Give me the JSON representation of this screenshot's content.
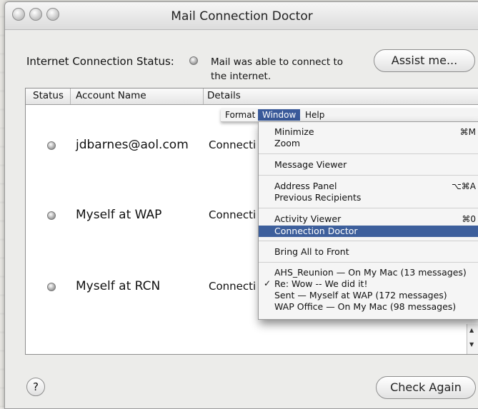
{
  "window": {
    "title": "Mail Connection Doctor"
  },
  "connection": {
    "label": "Internet Connection Status:",
    "status_line1": "Mail was able to connect to",
    "status_line2": "the internet.",
    "assist_button": "Assist me..."
  },
  "table": {
    "columns": [
      "Status",
      "Account Name",
      "Details"
    ],
    "rows": [
      {
        "account": "jdbarnes@aol.com",
        "details": "Connecti"
      },
      {
        "account": "Myself at WAP",
        "details": "Connecti"
      },
      {
        "account": "Myself at RCN",
        "details": "Connecti"
      }
    ]
  },
  "menubar": {
    "items": [
      "Format",
      "Window",
      "Help"
    ]
  },
  "window_menu": {
    "items": [
      {
        "label": "Minimize",
        "shortcut": "⌘M"
      },
      {
        "label": "Zoom",
        "shortcut": ""
      },
      {
        "label": "Message Viewer",
        "shortcut": ""
      },
      {
        "label": "Address Panel",
        "shortcut": "⌥⌘A"
      },
      {
        "label": "Previous Recipients",
        "shortcut": ""
      },
      {
        "label": "Activity Viewer",
        "shortcut": "⌘0"
      },
      {
        "label": "Connection Doctor",
        "shortcut": ""
      },
      {
        "label": "Bring All to Front",
        "shortcut": ""
      },
      {
        "label": "AHS_Reunion — On My Mac (13 messages)",
        "shortcut": ""
      },
      {
        "label": "Re: Wow -- We did it!",
        "shortcut": "",
        "checked": "✓"
      },
      {
        "label": "Sent — Myself at WAP (172 messages)",
        "shortcut": ""
      },
      {
        "label": "WAP Office — On My Mac (98 messages)",
        "shortcut": ""
      }
    ]
  },
  "footer": {
    "help": "?",
    "check_again": "Check Again"
  }
}
